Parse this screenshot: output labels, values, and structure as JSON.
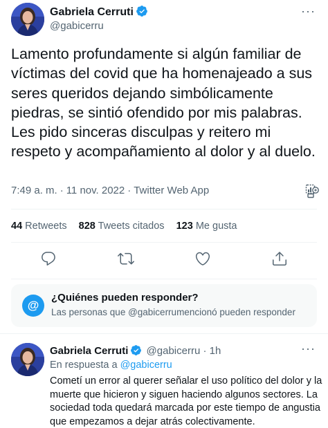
{
  "tweet": {
    "author_name": "Gabriela Cerruti",
    "author_handle": "@gabicerru",
    "text": "Lamento profundamente si algún familiar de víctimas del covid que ha homenajeado  a sus seres queridos dejando simbólicamente piedras, se sintió ofendido por mis palabras. Les pido sinceras disculpas y reitero mi respeto y acompañamiento al dolor y al duelo.",
    "time": "7:49 a. m.",
    "date": "11 nov. 2022",
    "source": "Twitter Web App",
    "more_icon": "more-horizontal-icon",
    "verified_icon": "verified-badge-icon",
    "analytics_icon": "analytics-icon"
  },
  "stats": {
    "retweets_count": "44",
    "retweets_label": "Retweets",
    "quotes_count": "828",
    "quotes_label": "Tweets citados",
    "likes_count": "123",
    "likes_label": "Me gusta"
  },
  "actions": [
    {
      "name": "reply",
      "icon": "comment-icon"
    },
    {
      "name": "retweet",
      "icon": "retweet-icon"
    },
    {
      "name": "like",
      "icon": "heart-icon"
    },
    {
      "name": "share",
      "icon": "share-icon"
    }
  ],
  "reply_restriction": {
    "icon": "at-icon",
    "title": "¿Quiénes pueden responder?",
    "subtitle": "Las personas que @gabicerrumencionó pueden responder"
  },
  "reply": {
    "author_name": "Gabriela Cerruti",
    "author_handle": "@gabicerru",
    "separator": "·",
    "time": "1h",
    "in_reply_prefix": "En respuesta a",
    "in_reply_handle": "@gabicerru",
    "text": "Cometí un error al querer señalar el uso político del dolor y la muerte que hicieron y siguen haciendo algunos sectores. La sociedad toda quedará marcada por este tiempo de angustia que empezamos a dejar atrás colectivamente."
  },
  "colors": {
    "accent": "#1d9bf0",
    "text_primary": "#0f1419",
    "text_secondary": "#536471",
    "divider": "#eff3f4"
  }
}
